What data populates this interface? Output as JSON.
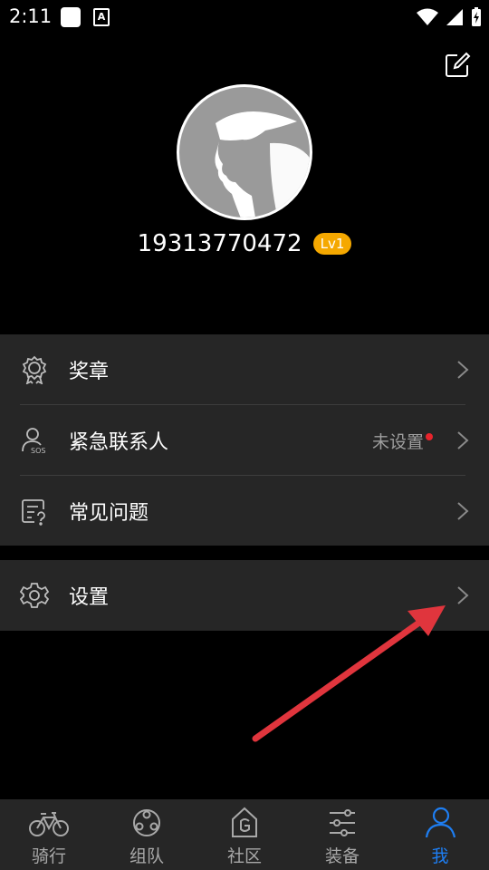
{
  "status_bar": {
    "time": "2:11"
  },
  "profile": {
    "phone": "19313770472",
    "level": "Lv1",
    "edit_icon": "edit-icon"
  },
  "menu": [
    {
      "label": "奖章",
      "icon": "medal-icon"
    },
    {
      "label": "紧急联系人",
      "icon": "sos-contact-icon",
      "value": "未设置",
      "dot": true
    },
    {
      "label": "常见问题",
      "icon": "faq-icon"
    }
  ],
  "settings": {
    "label": "设置",
    "icon": "gear-icon"
  },
  "tabs": [
    {
      "label": "骑行",
      "icon": "bicycle-icon",
      "active": false
    },
    {
      "label": "组队",
      "icon": "team-icon",
      "active": false
    },
    {
      "label": "社区",
      "icon": "community-icon",
      "active": false
    },
    {
      "label": "装备",
      "icon": "equipment-icon",
      "active": false
    },
    {
      "label": "我",
      "icon": "person-icon",
      "active": true
    }
  ],
  "colors": {
    "accent": "#1e7ef2",
    "badge": "#f5a800",
    "alert_dot": "#e8242c",
    "annotation": "#e0353d"
  }
}
